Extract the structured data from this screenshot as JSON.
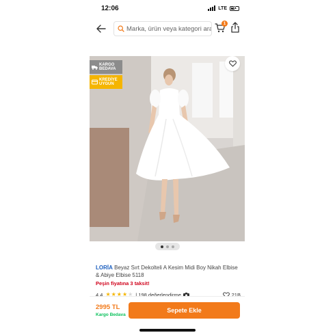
{
  "status_bar": {
    "time": "12:06",
    "network": "LTE",
    "battery": "41"
  },
  "top_nav": {
    "search_placeholder": "Marka, ürün veya kategori ara",
    "cart_count": "1"
  },
  "product_image": {
    "badges": {
      "cargo_line1": "KARGO",
      "cargo_line2": "BEDAVA",
      "credit_line1": "KREDİYE",
      "credit_line2": "UYGUN"
    },
    "carousel": {
      "total": 3,
      "active_index": 0
    }
  },
  "product": {
    "brand": "LORİA",
    "title": "Beyaz Sırt Dekolteli A Kesim Midi Boy Nikah Elbise & Abiye Elbise 5118",
    "installment": "Peşin fiyatına 3 taksit!",
    "rating": "4.4",
    "stars_filled": 4,
    "reviews": "| 198 değerlendirme",
    "favorites": "21B"
  },
  "bottom_bar": {
    "price": "2995 TL",
    "cargo_free": "Kargo Bedava",
    "add_to_cart": "Sepete Ekle"
  },
  "colors": {
    "accent": "#f27a1a",
    "brand_link": "#1c5fbf",
    "installment_red": "#d0021b",
    "cargo_green": "#0bc15c",
    "star_yellow": "#f5b500"
  },
  "icons": {
    "back": "arrow-left-icon",
    "search": "search-icon",
    "cart": "cart-icon",
    "share": "share-icon",
    "favorite": "heart-icon",
    "truck": "truck-icon",
    "credit": "credit-icon",
    "star": "star-icon",
    "camera": "camera-icon"
  }
}
